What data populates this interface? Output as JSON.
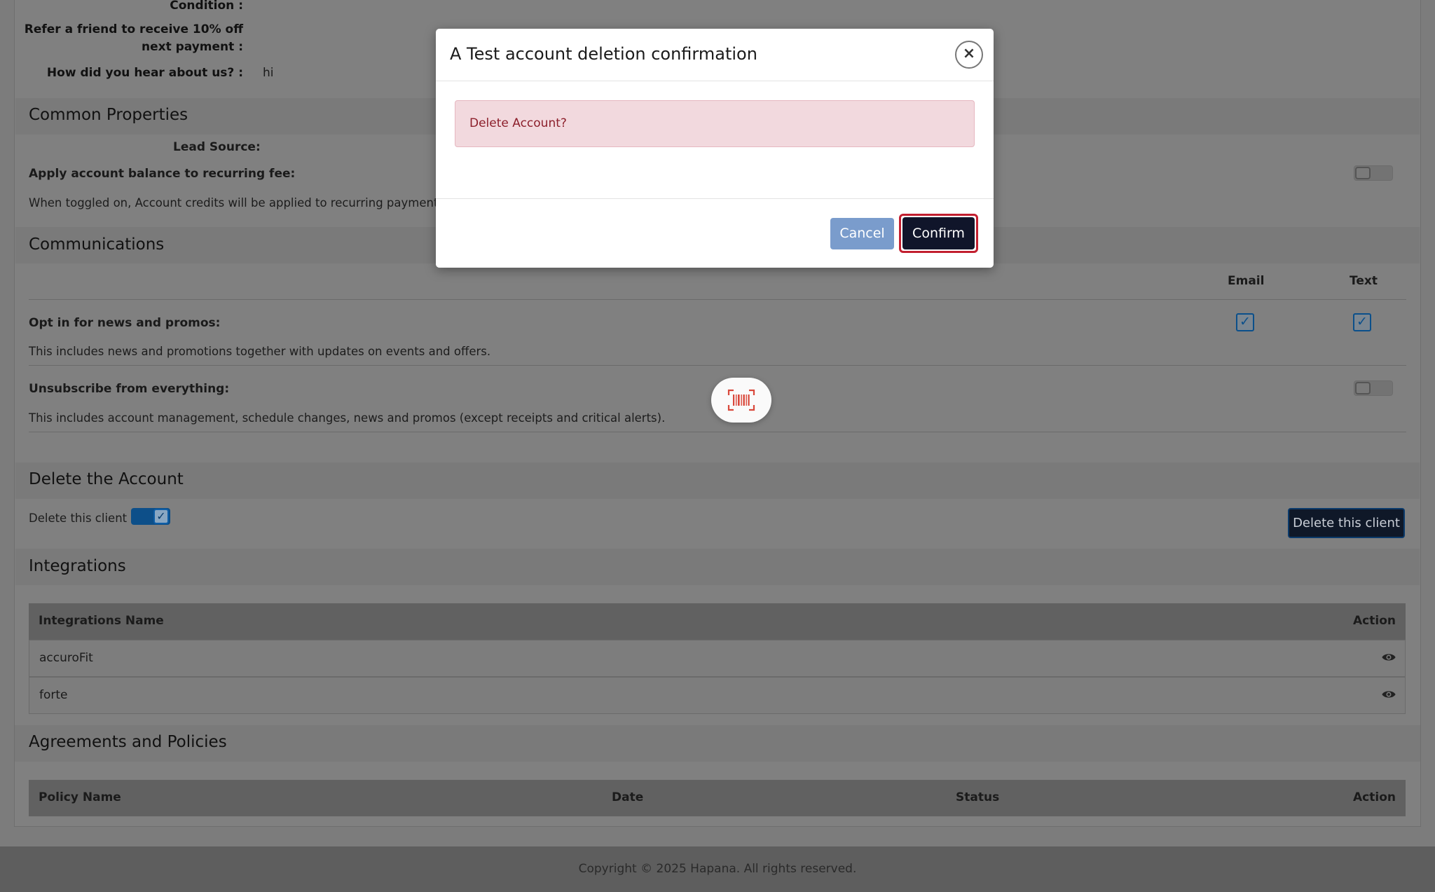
{
  "profile": {
    "condition_label": "Condition :",
    "refer_label": "Refer a friend to receive 10% off next payment :",
    "hear_label": "How did you hear about us? :",
    "hear_value": "hi"
  },
  "common": {
    "title": "Common Properties",
    "lead_source_label": "Lead Source:",
    "apply_balance_label": "Apply account balance to recurring fee:",
    "apply_balance_desc": "When toggled on, Account credits will be applied to recurring payments."
  },
  "communications": {
    "title": "Communications",
    "col_email": "Email",
    "col_text": "Text",
    "optin_label": "Opt in for news and promos:",
    "optin_desc": "This includes news and promotions together with updates on events and offers.",
    "unsub_label": "Unsubscribe from everything:",
    "unsub_desc": "This includes account management, schedule changes, news and promos (except receipts and critical alerts)."
  },
  "delete_account": {
    "title": "Delete the Account",
    "toggle_label": "Delete this client",
    "button": "Delete this client"
  },
  "integrations": {
    "title": "Integrations",
    "col_name": "Integrations Name",
    "col_action": "Action",
    "rows": [
      {
        "name": "accuroFit"
      },
      {
        "name": "forte"
      }
    ]
  },
  "agreements": {
    "title": "Agreements and Policies",
    "col_policy": "Policy Name",
    "col_date": "Date",
    "col_status": "Status",
    "col_action": "Action"
  },
  "footer": {
    "text": "Copyright © 2025 Hapana. All rights reserved."
  },
  "modal": {
    "title": "A Test account deletion confirmation",
    "alert": "Delete Account?",
    "cancel": "Cancel",
    "confirm": "Confirm"
  },
  "colors": {
    "accent": "#0b4f8a",
    "danger_ring": "#c21f2f",
    "alert_bg": "#f2d9de",
    "cancel_bg": "#7a9ccc",
    "confirm_bg": "#10152a"
  }
}
